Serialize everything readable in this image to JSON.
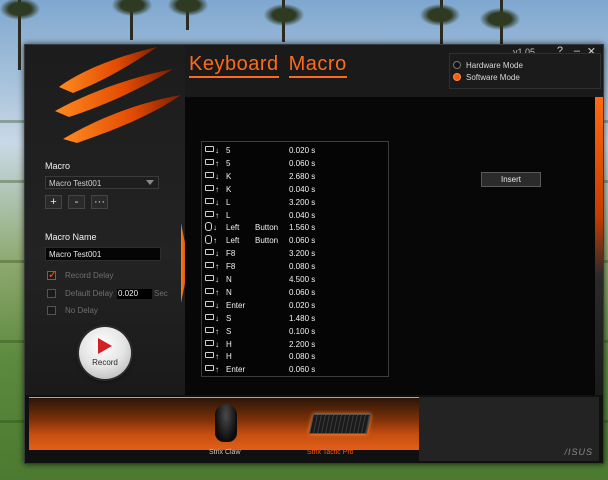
{
  "window": {
    "title_word1": "Keyboard",
    "title_word2": "Macro",
    "version": "v1.05",
    "help_label": "?",
    "minimize_label": "–",
    "close_label": "✕"
  },
  "modes": [
    {
      "label": "Hardware Mode",
      "selected": false
    },
    {
      "label": "Software Mode",
      "selected": true
    }
  ],
  "sidebar": {
    "macro_label": "Macro",
    "macro_selected": "Macro Test001",
    "add_label": "+",
    "remove_label": "-",
    "more_label": "···",
    "macro_name_label": "Macro  Name",
    "macro_name_value": "Macro Test001",
    "record_delay_label": "Record Delay",
    "record_delay_checked": true,
    "default_delay_label": "Default Delay",
    "default_delay_value": "0.020",
    "default_delay_unit": "Sec",
    "default_delay_checked": false,
    "no_delay_label": "No Delay",
    "no_delay_checked": false,
    "record_label": "Record"
  },
  "toolbar": {
    "edit_icon": "pencil-icon",
    "remove_label": "-",
    "up_icon": "triangle-up-icon",
    "down_icon": "triangle-down-icon",
    "insert_label": "Insert"
  },
  "macro_events": [
    {
      "device": "keyboard",
      "dir": "down",
      "key": "5",
      "button": "",
      "time": "0.020 s"
    },
    {
      "device": "keyboard",
      "dir": "up",
      "key": "5",
      "button": "",
      "time": "0.060 s"
    },
    {
      "device": "keyboard",
      "dir": "down",
      "key": "K",
      "button": "",
      "time": "2.680 s"
    },
    {
      "device": "keyboard",
      "dir": "up",
      "key": "K",
      "button": "",
      "time": "0.040 s"
    },
    {
      "device": "keyboard",
      "dir": "down",
      "key": "L",
      "button": "",
      "time": "3.200 s"
    },
    {
      "device": "keyboard",
      "dir": "up",
      "key": "L",
      "button": "",
      "time": "0.040 s"
    },
    {
      "device": "mouse",
      "dir": "down",
      "key": "Left",
      "button": "Button",
      "time": "1.560 s"
    },
    {
      "device": "mouse",
      "dir": "up",
      "key": "Left",
      "button": "Button",
      "time": "0.060 s"
    },
    {
      "device": "keyboard",
      "dir": "down",
      "key": "F8",
      "button": "",
      "time": "3.200 s"
    },
    {
      "device": "keyboard",
      "dir": "up",
      "key": "F8",
      "button": "",
      "time": "0.080 s"
    },
    {
      "device": "keyboard",
      "dir": "down",
      "key": "N",
      "button": "",
      "time": "4.500 s"
    },
    {
      "device": "keyboard",
      "dir": "up",
      "key": "N",
      "button": "",
      "time": "0.060 s"
    },
    {
      "device": "keyboard",
      "dir": "down",
      "key": "Enter",
      "button": "",
      "time": "0.020 s"
    },
    {
      "device": "keyboard",
      "dir": "down",
      "key": "S",
      "button": "",
      "time": "1.480 s"
    },
    {
      "device": "keyboard",
      "dir": "up",
      "key": "S",
      "button": "",
      "time": "0.100 s"
    },
    {
      "device": "keyboard",
      "dir": "down",
      "key": "H",
      "button": "",
      "time": "2.200 s"
    },
    {
      "device": "keyboard",
      "dir": "up",
      "key": "H",
      "button": "",
      "time": "0.080 s"
    },
    {
      "device": "keyboard",
      "dir": "up",
      "key": "Enter",
      "button": "",
      "time": "0.060 s"
    }
  ],
  "devices": [
    {
      "label": "Strix Claw",
      "selected": false
    },
    {
      "label": "Strix Tactic Pro",
      "selected": true
    }
  ],
  "colors": {
    "accent": "#ff6a1a",
    "selected_device": "#ff5a10",
    "unselected_device": "#c8c8c8"
  }
}
